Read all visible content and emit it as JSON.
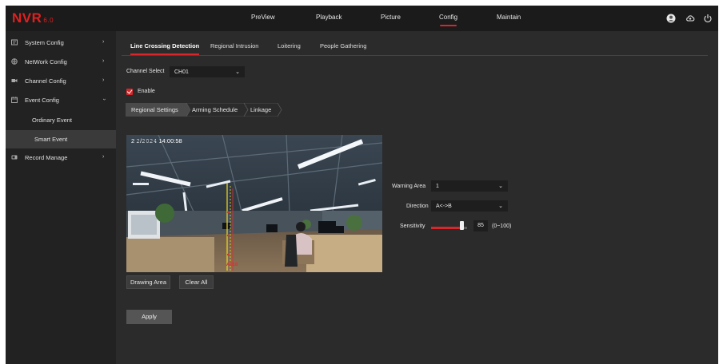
{
  "brand": {
    "name": "NVR",
    "version": "6.0"
  },
  "nav": {
    "items": [
      {
        "label": "PreView"
      },
      {
        "label": "Playback"
      },
      {
        "label": "Picture"
      },
      {
        "label": "Config",
        "active": true
      },
      {
        "label": "Maintain"
      }
    ]
  },
  "header_icons": [
    "user-avatar-icon",
    "cloud-icon",
    "power-icon"
  ],
  "sidebar": {
    "items": [
      {
        "label": "System Config",
        "icon": "system-config-icon",
        "expanded": false
      },
      {
        "label": "NetWork Config",
        "icon": "network-config-icon",
        "expanded": false
      },
      {
        "label": "Channel Config",
        "icon": "channel-config-icon",
        "expanded": false
      },
      {
        "label": "Event Config",
        "icon": "event-config-icon",
        "expanded": true
      },
      {
        "label": "Record Manage",
        "icon": "record-manage-icon",
        "expanded": false
      }
    ],
    "event_sub": [
      {
        "label": "Ordinary Event",
        "selected": false
      },
      {
        "label": "Smart Event",
        "selected": true
      }
    ]
  },
  "tabs": [
    {
      "label": "Line Crossing Detection",
      "active": true
    },
    {
      "label": "Regional Intrusion"
    },
    {
      "label": "Loitering"
    },
    {
      "label": "People Gathering"
    }
  ],
  "channel_select": {
    "label": "Channel Select",
    "value": "CH01"
  },
  "enable": {
    "label": "Enable",
    "checked": true
  },
  "steps": [
    {
      "label": "Regional Settings",
      "active": true
    },
    {
      "label": "Arming Schedule"
    },
    {
      "label": "Linkage"
    }
  ],
  "video": {
    "osd_date": "2",
    "osd_time": "14:00:58",
    "line_label": "A<->B"
  },
  "buttons": {
    "drawing_area": "Drawing Area",
    "clear_all": "Clear All",
    "apply": "Apply"
  },
  "settings": {
    "warning_area": {
      "label": "Warning Area",
      "value": "1"
    },
    "direction": {
      "label": "Direction",
      "value": "A<->B"
    },
    "sensitivity": {
      "label": "Sensitivity",
      "value": "85",
      "range": "(0~100)",
      "fraction": 0.85
    }
  },
  "colors": {
    "accent": "#d8262a",
    "background": "#2b2b2b",
    "sidebar": "#222222",
    "topbar": "#1b1b1b"
  }
}
